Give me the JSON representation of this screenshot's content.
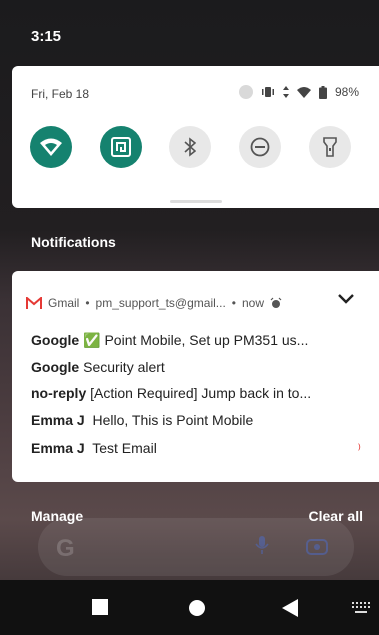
{
  "status_bar": {
    "time": "3:15"
  },
  "quick_settings": {
    "date": "Fri, Feb 18",
    "battery": "98%",
    "tiles": [
      {
        "name": "wifi",
        "icon": "wifi-icon",
        "active": true
      },
      {
        "name": "nfc",
        "icon": "nfc-icon",
        "active": true
      },
      {
        "name": "bluetooth",
        "icon": "bluetooth-icon",
        "active": false
      },
      {
        "name": "do-not-disturb",
        "icon": "dnd-icon",
        "active": false
      },
      {
        "name": "flashlight",
        "icon": "flashlight-icon",
        "active": false
      }
    ]
  },
  "notifications": {
    "header": "Notifications",
    "gmail": {
      "app": "Gmail",
      "account": "pm_support_ts@gmail...",
      "time": "now",
      "items": [
        {
          "sender": "Google",
          "emoji": "✅",
          "text": "Point Mobile, Set up PM351 us..."
        },
        {
          "sender": "Google",
          "text": "Security alert"
        },
        {
          "sender": "no-reply",
          "text": "[Action Required] Jump back in to..."
        },
        {
          "sender": "Emma J",
          "text": "Hello, This is Point Mobile"
        },
        {
          "sender": "Emma J",
          "text": "Test Email"
        }
      ]
    },
    "manage_label": "Manage",
    "clear_all_label": "Clear all"
  },
  "colors": {
    "tile_active": "#15826f",
    "gmail_red": "#e53935"
  }
}
